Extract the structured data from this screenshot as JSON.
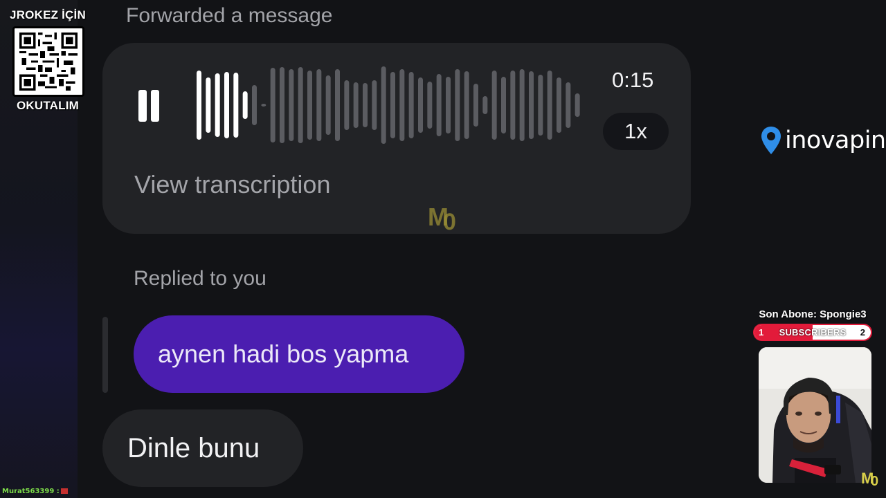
{
  "overlay": {
    "qr_title": "JROKEZ İÇİN",
    "qr_subtitle": "OKUTALIM",
    "viewer_line": "Murat563399 :",
    "brand_name": "inovapin",
    "brand_color": "#2f8ee8",
    "last_subscriber": "Son Abone: Spongie3",
    "subscribers": {
      "label": "SUBSCRIBERS",
      "start": "1",
      "goal": "2",
      "progress": 0.5,
      "color": "#e21b3a"
    }
  },
  "chat": {
    "forward_label": "Forwarded a message",
    "voice_message": {
      "state": "playing",
      "duration": "0:15",
      "speed": "1x",
      "transcription_link": "View transcription",
      "played_fraction": 0.13
    },
    "replied_label": "Replied to you",
    "reply_message": "aynen hadi bos yapma",
    "reply_bubble_color": "#4b1eb0",
    "message": "Dinle bunu"
  },
  "icons": {
    "pause": "pause-icon",
    "brand_pin": "location-pin-icon",
    "watermark": "md-watermark-logo"
  }
}
